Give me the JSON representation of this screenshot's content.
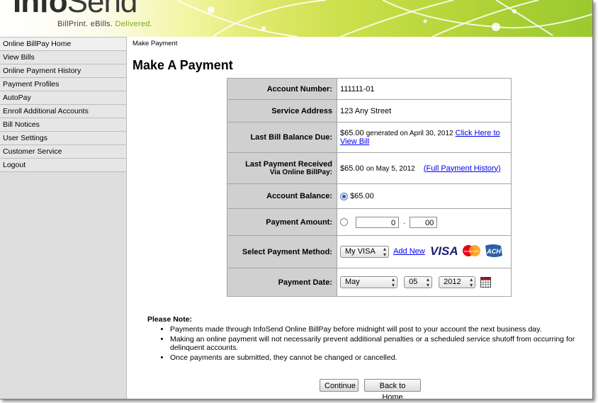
{
  "header": {
    "logo_main": "Info",
    "logo_send": "Send",
    "tagline_prefix": "BillPrint. eBills.",
    "tagline_highlight": "Delivered.",
    "colors": {
      "gradient_end": "#9cc930",
      "tagline_green": "#7aa51a"
    }
  },
  "sidebar": {
    "items": [
      {
        "label": "Online BillPay Home"
      },
      {
        "label": "View Bills"
      },
      {
        "label": "Online Payment History"
      },
      {
        "label": "Payment Profiles"
      },
      {
        "label": "AutoPay"
      },
      {
        "label": "Enroll Additional Accounts"
      },
      {
        "label": "Bill Notices"
      },
      {
        "label": "User Settings"
      },
      {
        "label": "Customer Service"
      },
      {
        "label": "Logout"
      }
    ]
  },
  "main": {
    "breadcrumb": "Make Payment",
    "title": "Make A Payment",
    "form": {
      "account_number_label": "Account Number:",
      "account_number": "111111-01",
      "service_address_label": "Service Address",
      "service_address": "123 Any Street",
      "last_bill_label": "Last Bill Balance Due:",
      "last_bill_amount": "$65.00",
      "last_bill_generated": "generated on April 30, 2012",
      "view_bill_link": "Click Here to View Bill",
      "last_payment_label": "Last Payment Received",
      "last_payment_sublabel": "Via Online BillPay:",
      "last_payment_amount": "$65.00",
      "last_payment_date": "on May 5, 2012",
      "payment_history_link": "(Full Payment History)",
      "account_balance_label": "Account Balance:",
      "account_balance": "$65.00",
      "payment_amount_label": "Payment Amount:",
      "payment_dollars": "0",
      "payment_dot": ".",
      "payment_cents": "00",
      "payment_method_label": "Select Payment Method:",
      "payment_method_selected": "My VISA",
      "add_new_link": "Add New",
      "payment_date_label": "Payment Date:",
      "payment_month": "May",
      "payment_day": "05",
      "payment_year": "2012"
    },
    "note": {
      "title": "Please Note:",
      "items": [
        "Payments made through InfoSend Online BillPay before midnight will post to your account the next business day.",
        "Making an online payment will not necessarily prevent additional penalties or a scheduled service shutoff from occurring for delinquent accounts.",
        "Once payments are submitted, they cannot be changed or cancelled."
      ]
    },
    "buttons": {
      "continue": "Continue",
      "back_home": "Back to Home"
    },
    "cards": {
      "visa": "VISA",
      "mastercard": "MasterCard",
      "ach": "ACH",
      "icons": [
        "visa-logo-icon",
        "mastercard-logo-icon",
        "ach-logo-icon",
        "calendar-icon"
      ]
    }
  }
}
